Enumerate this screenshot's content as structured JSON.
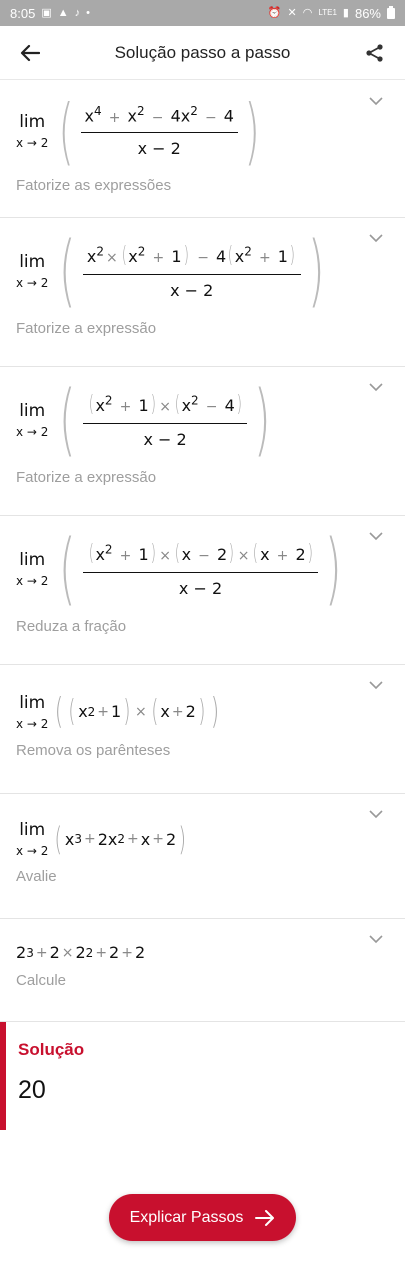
{
  "status_bar": {
    "time": "8:05",
    "battery": "86%",
    "network": "LTE1"
  },
  "app_bar": {
    "title": "Solução passo a passo"
  },
  "steps": [
    {
      "description": "Fatorize as expressões"
    },
    {
      "description": "Fatorize a expressão"
    },
    {
      "description": "Fatorize a expressão"
    },
    {
      "description": "Reduza a fração"
    },
    {
      "description": "Remova os parênteses"
    },
    {
      "description": "Avalie"
    },
    {
      "description": "Calcule"
    }
  ],
  "math": {
    "lim": "lim",
    "lim_sub": "x → 2",
    "denominator": "x − 2"
  },
  "solution": {
    "label": "Solução",
    "value": "20"
  },
  "explain_button": {
    "label": "Explicar Passos"
  },
  "colors": {
    "accent": "#c8102e",
    "status_bar": "#a9a9a9",
    "muted_text": "#9e9e9e"
  }
}
